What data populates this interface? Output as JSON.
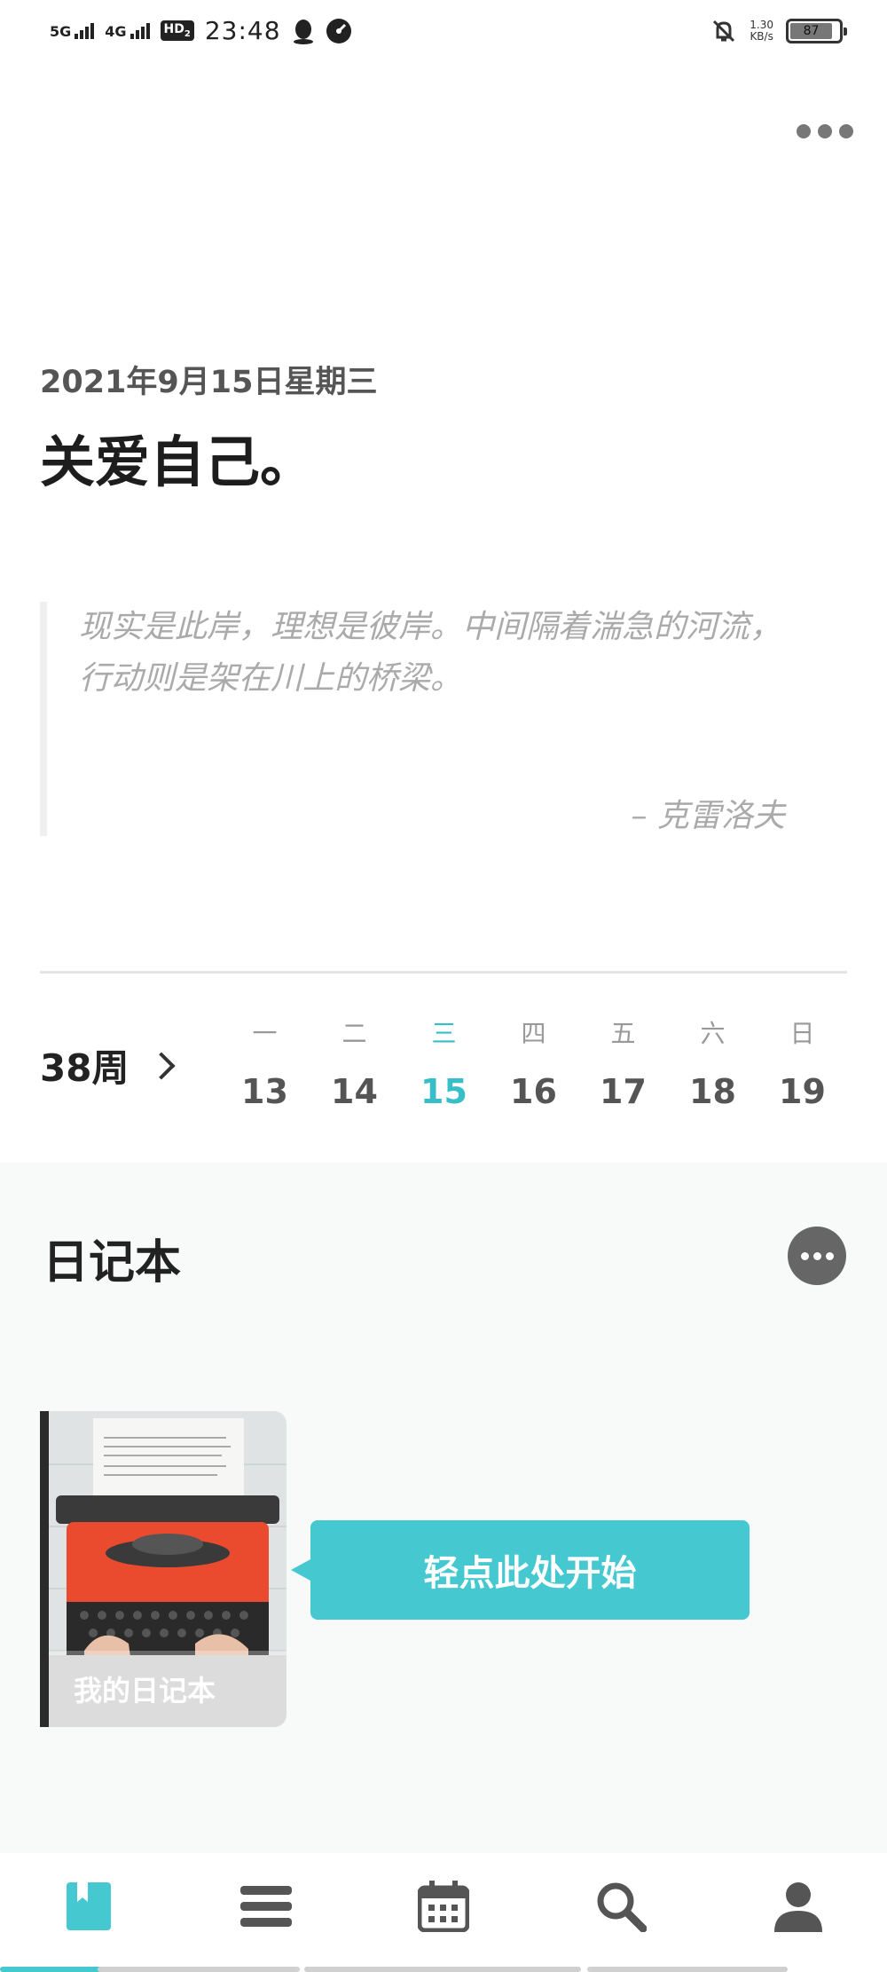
{
  "status_bar": {
    "signal1": "5G",
    "signal2": "4G",
    "hd": "HD",
    "hd_sub": "2",
    "time": "23:48",
    "net_speed_value": "1.30",
    "net_speed_unit": "KB/s",
    "battery": "87",
    "battery_level": 0.87
  },
  "header": {
    "date": "2021年9月15日星期三",
    "headline": "关爱自己。"
  },
  "quote": {
    "text": "现实是此岸，理想是彼岸。中间隔着湍急的河流，行动则是架在川上的桥梁。",
    "author": "– 克雷洛夫"
  },
  "week": {
    "label": "38周",
    "days": [
      {
        "weekday": "一",
        "date": "13",
        "active": false
      },
      {
        "weekday": "二",
        "date": "14",
        "active": false
      },
      {
        "weekday": "三",
        "date": "15",
        "active": true
      },
      {
        "weekday": "四",
        "date": "16",
        "active": false
      },
      {
        "weekday": "五",
        "date": "17",
        "active": false
      },
      {
        "weekday": "六",
        "date": "18",
        "active": false
      },
      {
        "weekday": "日",
        "date": "19",
        "active": false
      }
    ]
  },
  "journal": {
    "title": "日记本",
    "notebook_label": "我的日记本",
    "start_hint": "轻点此处开始"
  },
  "nav": {
    "items": [
      "bookmark-icon",
      "list-icon",
      "calendar-icon",
      "search-icon",
      "profile-icon"
    ],
    "active_index": 0
  },
  "colors": {
    "accent": "#45c8cf",
    "accent_text": "#38bec9"
  }
}
